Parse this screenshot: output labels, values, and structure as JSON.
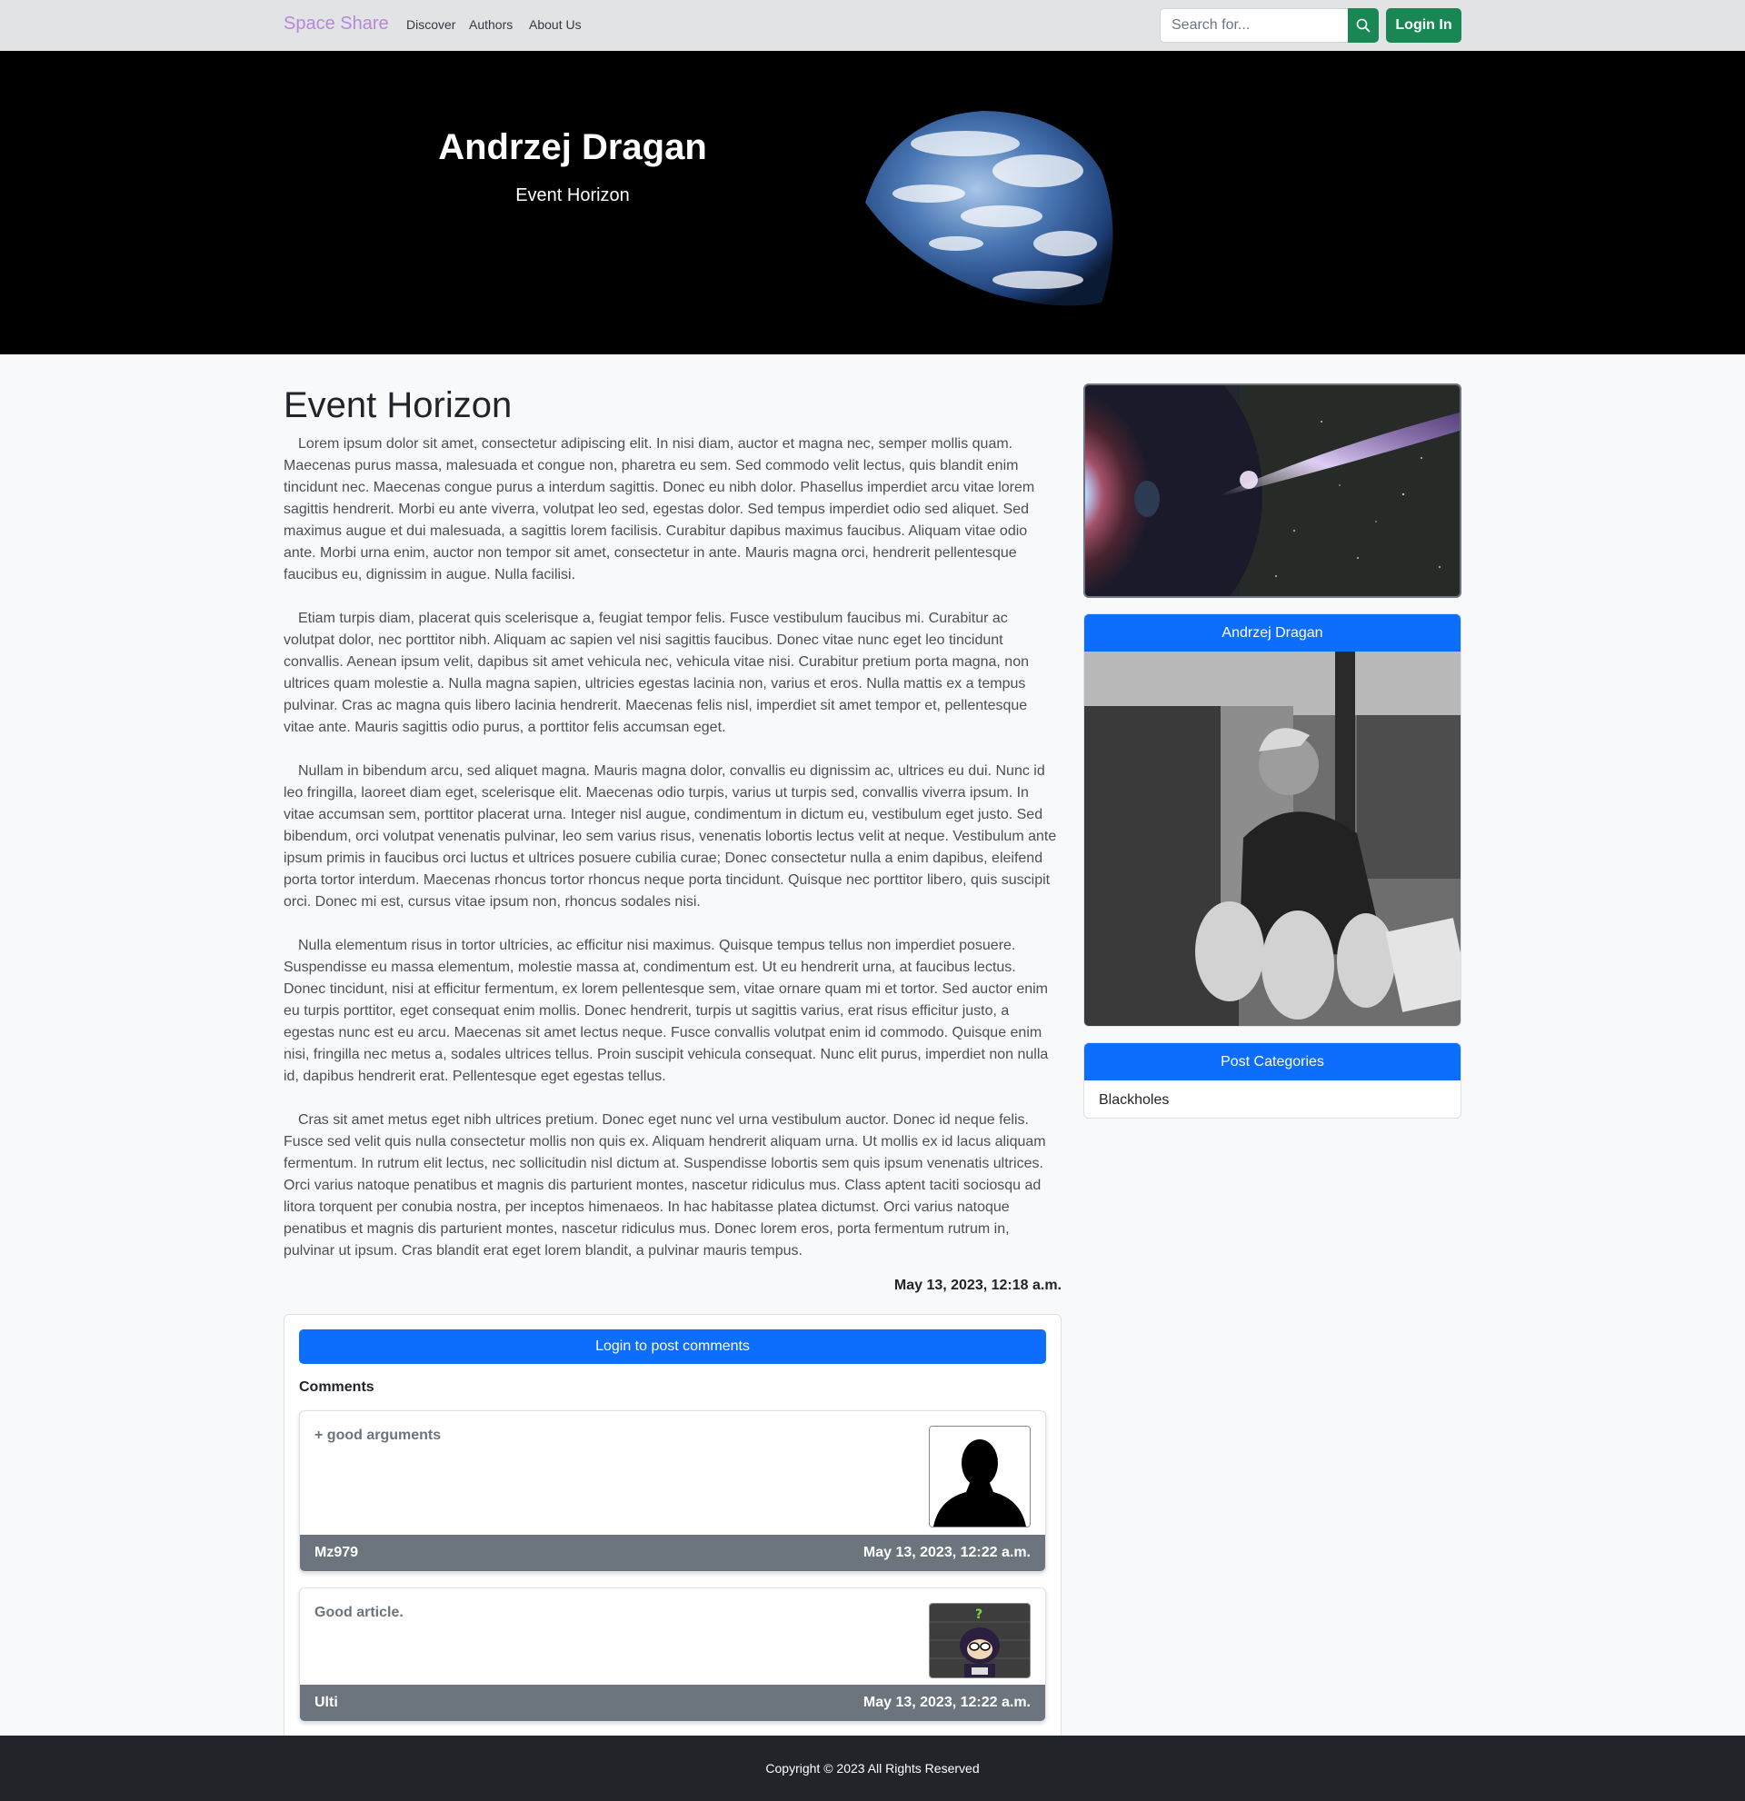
{
  "navbar": {
    "brand": "Space Share",
    "links": [
      "Discover",
      "Authors",
      "About Us"
    ],
    "search_placeholder": "Search for...",
    "login_label": "Login In"
  },
  "hero": {
    "author": "Andrzej Dragan",
    "subtitle": "Event Horizon"
  },
  "post": {
    "title": "Event Horizon",
    "paragraphs": [
      "Lorem ipsum dolor sit amet, consectetur adipiscing elit. In nisi diam, auctor et magna nec, semper mollis quam. Maecenas purus massa, malesuada et congue non, pharetra eu sem. Sed commodo velit lectus, quis blandit enim tincidunt nec. Maecenas congue purus a interdum sagittis. Donec eu nibh dolor. Phasellus imperdiet arcu vitae lorem sagittis hendrerit. Morbi eu ante viverra, volutpat leo sed, egestas dolor. Sed tempus imperdiet odio sed aliquet. Sed maximus augue et dui malesuada, a sagittis lorem facilisis. Curabitur dapibus maximus faucibus. Aliquam vitae odio ante. Morbi urna enim, auctor non tempor sit amet, consectetur in ante. Mauris magna orci, hendrerit pellentesque faucibus eu, dignissim in augue. Nulla facilisi.",
      "Etiam turpis diam, placerat quis scelerisque a, feugiat tempor felis. Fusce vestibulum faucibus mi. Curabitur ac volutpat dolor, nec porttitor nibh. Aliquam ac sapien vel nisi sagittis faucibus. Donec vitae nunc eget leo tincidunt convallis. Aenean ipsum velit, dapibus sit amet vehicula nec, vehicula vitae nisi. Curabitur pretium porta magna, non ultrices quam molestie a. Nulla magna sapien, ultricies egestas lacinia non, varius et eros. Nulla mattis ex a tempus pulvinar. Cras ac magna quis libero lacinia hendrerit. Maecenas felis nisl, imperdiet sit amet tempor et, pellentesque vitae ante. Mauris sagittis odio purus, a porttitor felis accumsan eget.",
      "Nullam in bibendum arcu, sed aliquet magna. Mauris magna dolor, convallis eu dignissim ac, ultrices eu dui. Nunc id leo fringilla, laoreet diam eget, scelerisque elit. Maecenas odio turpis, varius ut turpis sed, convallis viverra ipsum. In vitae accumsan sem, porttitor placerat urna. Integer nisl augue, condimentum in dictum eu, vestibulum eget justo. Sed bibendum, orci volutpat venenatis pulvinar, leo sem varius risus, venenatis lobortis lectus velit at neque. Vestibulum ante ipsum primis in faucibus orci luctus et ultrices posuere cubilia curae; Donec consectetur nulla a enim dapibus, eleifend porta tortor interdum. Maecenas rhoncus tortor rhoncus neque porta tincidunt. Quisque nec porttitor libero, quis suscipit orci. Donec mi est, cursus vitae ipsum non, rhoncus sodales nisi.",
      "Nulla elementum risus in tortor ultricies, ac efficitur nisi maximus. Quisque tempus tellus non imperdiet posuere. Suspendisse eu massa elementum, molestie massa at, condimentum est. Ut eu hendrerit urna, at faucibus lectus. Donec tincidunt, nisi at efficitur fermentum, ex lorem pellentesque sem, vitae ornare quam mi et tortor. Sed auctor enim eu turpis porttitor, eget consequat enim mollis. Donec hendrerit, turpis ut sagittis varius, erat risus efficitur justo, a egestas nunc est eu arcu. Maecenas sit amet lectus neque. Fusce convallis volutpat enim id commodo. Quisque enim nisi, fringilla nec metus a, sodales ultrices tellus. Proin suscipit vehicula consequat. Nunc elit purus, imperdiet non nulla id, dapibus hendrerit erat. Pellentesque eget egestas tellus.",
      "Cras sit amet metus eget nibh ultrices pretium. Donec eget nunc vel urna vestibulum auctor. Donec id neque felis. Fusce sed velit quis nulla consectetur mollis non quis ex. Aliquam hendrerit aliquam urna. Ut mollis ex id lacus aliquam fermentum. In rutrum elit lectus, nec sollicitudin nisl dictum at. Suspendisse lobortis sem quis ipsum venenatis ultrices. Orci varius natoque penatibus et magnis dis parturient montes, nascetur ridiculus mus. Class aptent taciti sociosqu ad litora torquent per conubia nostra, per inceptos himenaeos. In hac habitasse platea dictumst. Orci varius natoque penatibus et magnis dis parturient montes, nascetur ridiculus mus. Donec lorem eros, porta fermentum rutrum in, pulvinar ut ipsum. Cras blandit erat eget lorem blandit, a pulvinar mauris tempus."
    ],
    "date": "May 13, 2023, 12:18 a.m."
  },
  "comments": {
    "login_button": "Login to post comments",
    "heading": "Comments",
    "items": [
      {
        "text": "+ good arguments",
        "user": "Mz979",
        "date": "May 13, 2023, 12:22 a.m."
      },
      {
        "text": "Good article.",
        "user": "Ulti",
        "date": "May 13, 2023, 12:22 a.m."
      }
    ]
  },
  "sidebar": {
    "author_name": "Andrzej Dragan",
    "categories_title": "Post Categories",
    "categories": [
      "Blackholes"
    ]
  },
  "footer": {
    "copyright": "Copyright © 2023 All Rights Reserved"
  },
  "colors": {
    "primary": "#0d6efd",
    "success": "#198754",
    "secondary": "#6c757d",
    "brand": "#b788d8",
    "dark": "#212529"
  }
}
